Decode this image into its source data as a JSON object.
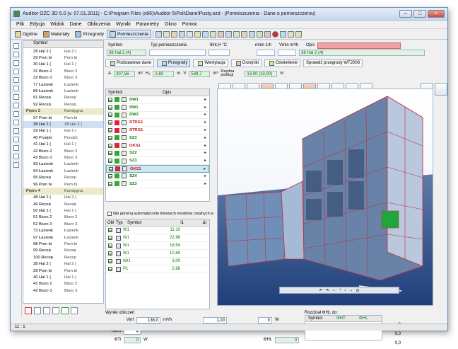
{
  "window": {
    "title": "Auditor OZC 3D 5.0  [v. 07.01.2011] - C:\\Program Files (x86)\\Auditor 5\\Poli\\Dane\\Pusty.ozd - [Pomieszczenia - Dane o pomieszczeniu]"
  },
  "menu": [
    "Plik",
    "Edycja",
    "Widok",
    "Dane",
    "Obliczenia",
    "Wyniki",
    "Parametry",
    "Okno",
    "Pomoc"
  ],
  "toolbar": {
    "ogolne": "Ogólne",
    "materialy": "Materiały",
    "przegrody": "Przegrody",
    "pomieszczenia": "Pomieszczenia"
  },
  "tree": {
    "header": {
      "symbol": "Symbol"
    },
    "rows": [
      {
        "a": "28 Hal 2 (",
        "b": "Hal 2 ("
      },
      {
        "a": "29 Pom bi",
        "b": "Pom bi"
      },
      {
        "a": "30 Hal 1 (",
        "b": "Hal 1 ("
      },
      {
        "a": "31 Biuro 2",
        "b": "Biuro 2"
      },
      {
        "a": "32 Biuro 3",
        "b": "Biuro 3"
      },
      {
        "a": "77 Łazienk",
        "b": "Łazienk"
      },
      {
        "a": "89 Łazienk",
        "b": "Łazienk"
      },
      {
        "a": "91 Recep",
        "b": "Recep"
      },
      {
        "a": "92 Recep",
        "b": "Recep"
      },
      {
        "a": "Piętro 3",
        "b": "Kondygna",
        "floor": true
      },
      {
        "a": "37 Pom bi",
        "b": "Pom bi"
      },
      {
        "a": "38 Hal 2 (",
        "b": "38 Hal 2 (",
        "sel": true
      },
      {
        "a": "39 Hal 1 (",
        "b": "Hal 1 ("
      },
      {
        "a": "40 Przejść",
        "b": "Przejść"
      },
      {
        "a": "41 Hal 1 (",
        "b": "Hal 1 ("
      },
      {
        "a": "42 Biuro 2",
        "b": "Biuro 2"
      },
      {
        "a": "43 Biuro 3",
        "b": "Biuro 3"
      },
      {
        "a": "93 Łazienk",
        "b": "Łazienk"
      },
      {
        "a": "94 Łazienk",
        "b": "Łazienk"
      },
      {
        "a": "95 Recep",
        "b": "Recep"
      },
      {
        "a": "96 Pom bi",
        "b": "Pom bi"
      },
      {
        "a": "Piętro 4",
        "b": "Kondygna",
        "floor": true
      },
      {
        "a": "48 Hal 2 (",
        "b": "Hal 2 ("
      },
      {
        "a": "49 Recep",
        "b": "Recep"
      },
      {
        "a": "50 Hal 1 (",
        "b": "Hal 1 ("
      },
      {
        "a": "51 Biuro 2",
        "b": "Biuro 2"
      },
      {
        "a": "52 Biuro 3",
        "b": "Biuro 3"
      },
      {
        "a": "73 Łazienk",
        "b": "Łazienk"
      },
      {
        "a": "97 Łazienk",
        "b": "Łazienk"
      },
      {
        "a": "98 Pom bi",
        "b": "Pom bi"
      },
      {
        "a": "99 Recep",
        "b": "Recep"
      },
      {
        "a": "100 Recep",
        "b": "Recep"
      },
      {
        "a": "38 Hal 2 (",
        "b": "Hal 2 ("
      },
      {
        "a": "39 Pom bi",
        "b": "Pom bi"
      },
      {
        "a": "40 Hal 1 (",
        "b": "Hal 1 ("
      },
      {
        "a": "41 Biuro 2",
        "b": "Biuro 2"
      },
      {
        "a": "42 Biuro 3",
        "b": "Biuro 3"
      }
    ]
  },
  "room": {
    "symbol_label": "Symbol",
    "symbol": "38 Hal 2 (4)",
    "typ_label": "Typ pomieszczenia",
    "theta_label": "θint,H °C",
    "nmin_label": "nmin 1/h",
    "vmin_label": "Vmin m³/h",
    "opis_label": "Opis",
    "opis_value": "38 Hal 2 (4)"
  },
  "tabs": [
    "Podstawowe dane",
    "Przegrody",
    "Wentylacja",
    "Grzejniki",
    "Oświetlenie",
    "Sprawdź przegrody WT2008"
  ],
  "metrics": {
    "a_label": "A",
    "a": "207,56",
    "a_unit": "m²",
    "h_label": "H₁",
    "h": "2,60",
    "h_unit": "m",
    "v_label": "V",
    "v": "539,7",
    "v_unit": "m³",
    "rz_label": "Rzędna podłogi",
    "rz": "13,00 (13,00)",
    "rz_unit": "m"
  },
  "partlist": {
    "header": {
      "symbol": "Symbol",
      "opis": "Opis"
    },
    "rows": [
      {
        "n": "DW1",
        "red": false
      },
      {
        "n": "SW1",
        "red": false
      },
      {
        "n": "DW2",
        "red": false
      },
      {
        "n": "STRG1",
        "red": true
      },
      {
        "n": "STRG1",
        "red": true
      },
      {
        "n": "SZ3",
        "red": false
      },
      {
        "n": "OKS1",
        "red": true
      },
      {
        "n": "SZ2",
        "red": false
      },
      {
        "n": "SZ3",
        "red": false
      },
      {
        "n": "OKS1",
        "red": true,
        "sel": true
      },
      {
        "n": "SZ4",
        "red": false
      },
      {
        "n": "SZ3",
        "red": false
      }
    ]
  },
  "checkbox_label": "Nie generuj automatycznie liniowych mostków cieplnych w",
  "partlist2": {
    "header": {
      "obl": "Obl",
      "typ": "Typ",
      "symbol": "Symbol",
      "l1": "l1",
      "dl": "Δl"
    },
    "rows": [
      {
        "s": "W1",
        "l": "11,10"
      },
      {
        "s": "W1",
        "l": "22,96"
      },
      {
        "s": "W1",
        "l": "16,54"
      },
      {
        "s": "W1",
        "l": "10,89"
      },
      {
        "s": "IW1",
        "l": "3,00"
      },
      {
        "s": "P1",
        "l": "2,88"
      }
    ]
  },
  "results": {
    "title": "Wyniki obliczeń",
    "vinf_label": "Vinf",
    "vinf": "136,0",
    "vinf_unit": "m³/h",
    "nwin_label": "Nwin",
    "nwin": "4",
    "fi_label": "ΦTi",
    "fi": "0",
    "fi_unit": "W",
    "n": "1,00",
    "rozdz_title": "Rozdział ΦHL do:",
    "rz_cols": [
      "Symbol",
      "ΦHT",
      "ΦHL"
    ],
    "phi_hl": "0",
    "hl_label": "ΦHL",
    "hl": "0",
    "w": "W",
    "right_vals": [
      "0",
      "0,0",
      "0,0"
    ]
  },
  "status": "11 : 1"
}
